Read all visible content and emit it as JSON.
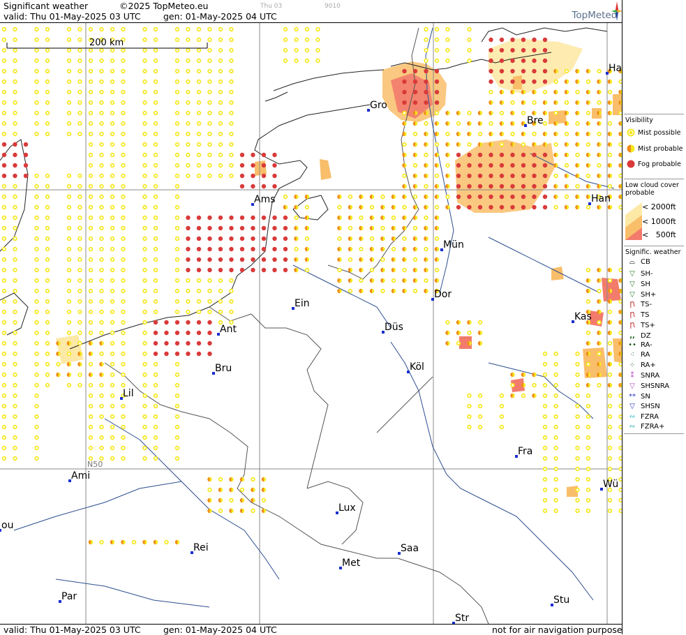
{
  "header": {
    "title": "Significant weather",
    "copyright": "©2025 TopMeteo.eu",
    "faint1": "Thu 03",
    "faint2": "9010",
    "valid": "valid:  Thu  01-May-2025  03 UTC",
    "gen": "gen: 01-May-2025 04 UTC",
    "brand": "TopMeteo"
  },
  "footer": {
    "valid": "valid:  Thu  01-May-2025  03 UTC",
    "gen": "gen: 01-May-2025 04 UTC",
    "note": "not for air navigation purposes"
  },
  "map": {
    "scale_label": "200 km",
    "lat_label": "N50",
    "cities": [
      {
        "name": "Ha"
      },
      {
        "name": "Gro"
      },
      {
        "name": "Bre"
      },
      {
        "name": "Ams"
      },
      {
        "name": "Han"
      },
      {
        "name": "Mün"
      },
      {
        "name": "Dor"
      },
      {
        "name": "Ein"
      },
      {
        "name": "Ant"
      },
      {
        "name": "Düs"
      },
      {
        "name": "Kas"
      },
      {
        "name": "Bru"
      },
      {
        "name": "Köl"
      },
      {
        "name": "Lil"
      },
      {
        "name": "Fra"
      },
      {
        "name": "Ami"
      },
      {
        "name": "Wü"
      },
      {
        "name": "Lux"
      },
      {
        "name": "ou"
      },
      {
        "name": "Rei"
      },
      {
        "name": "Saa"
      },
      {
        "name": "Met"
      },
      {
        "name": "Par"
      },
      {
        "name": "Stu"
      },
      {
        "name": "Str"
      }
    ]
  },
  "legend": {
    "visibility_title": "Visibility",
    "visibility_items": [
      "Mist possible",
      "Mist probable",
      "Fog probable"
    ],
    "cloud_title_1": "Low cloud cover",
    "cloud_title_2": "probable",
    "cloud_items": [
      "< 2000ft",
      "< 1000ft",
      "<   500ft"
    ],
    "wx_title": "Signific. weather",
    "wx_items": [
      "CB",
      "SH-",
      "SH",
      "SH+",
      "TS-",
      "TS",
      "TS+",
      "DZ",
      "RA-",
      "RA",
      "RA+",
      "SNRA",
      "SHSNRA",
      "SN",
      "SHSN",
      "FZRA",
      "FZRA+"
    ]
  },
  "colors": {
    "mist_possible": "#f5e81e",
    "mist_probable": "#f08a1c",
    "fog_probable": "#d93a3a",
    "cloud_2000": "#fde9a6",
    "cloud_1000": "#f9be6a",
    "cloud_500": "#f27b6c"
  }
}
